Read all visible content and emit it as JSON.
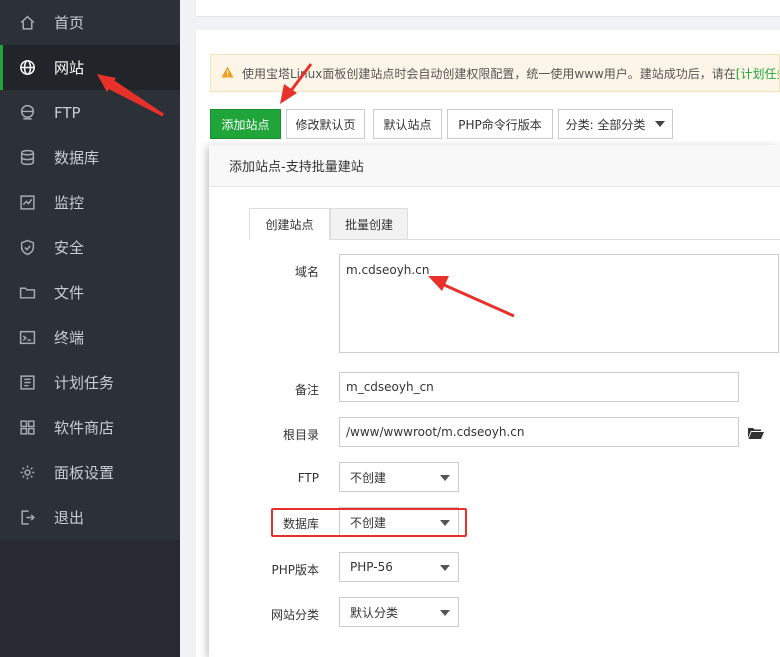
{
  "sidebar": {
    "items": [
      {
        "label": "首页",
        "icon": "home-icon"
      },
      {
        "label": "网站",
        "icon": "globe-icon",
        "active": true
      },
      {
        "label": "FTP",
        "icon": "ftp-globe-icon"
      },
      {
        "label": "数据库",
        "icon": "database-icon"
      },
      {
        "label": "监控",
        "icon": "monitor-icon"
      },
      {
        "label": "安全",
        "icon": "shield-icon"
      },
      {
        "label": "文件",
        "icon": "folder-icon"
      },
      {
        "label": "终端",
        "icon": "terminal-icon"
      },
      {
        "label": "计划任务",
        "icon": "schedule-icon"
      },
      {
        "label": "软件商店",
        "icon": "grid-icon"
      },
      {
        "label": "面板设置",
        "icon": "gear-icon"
      },
      {
        "label": "退出",
        "icon": "logout-icon"
      }
    ]
  },
  "notice": {
    "text": "使用宝塔Linux面板创建站点时会自动创建权限配置，统一使用www用户。建站成功后，请在",
    "link": "[计划任务"
  },
  "toolbar": {
    "add_site": "添加站点",
    "edit_default_page": "修改默认页",
    "default_site": "默认站点",
    "php_cli_version": "PHP命令行版本",
    "category": "分类: 全部分类"
  },
  "dialog": {
    "title": "添加站点-支持批量建站",
    "tabs": [
      "创建站点",
      "批量创建"
    ],
    "fields": {
      "domain": {
        "label": "域名",
        "value": "m.cdseoyh.cn"
      },
      "remark": {
        "label": "备注",
        "value": "m_cdseoyh_cn"
      },
      "root": {
        "label": "根目录",
        "value": "/www/wwwroot/m.cdseoyh.cn"
      },
      "ftp": {
        "label": "FTP",
        "value": "不创建"
      },
      "database": {
        "label": "数据库",
        "value": "不创建"
      },
      "php": {
        "label": "PHP版本",
        "value": "PHP-56"
      },
      "site_category": {
        "label": "网站分类",
        "value": "默认分类"
      }
    }
  },
  "colors": {
    "accent": "#20a53a",
    "sidebar_bg": "#2c3138",
    "annotation_red": "#e8312a"
  }
}
